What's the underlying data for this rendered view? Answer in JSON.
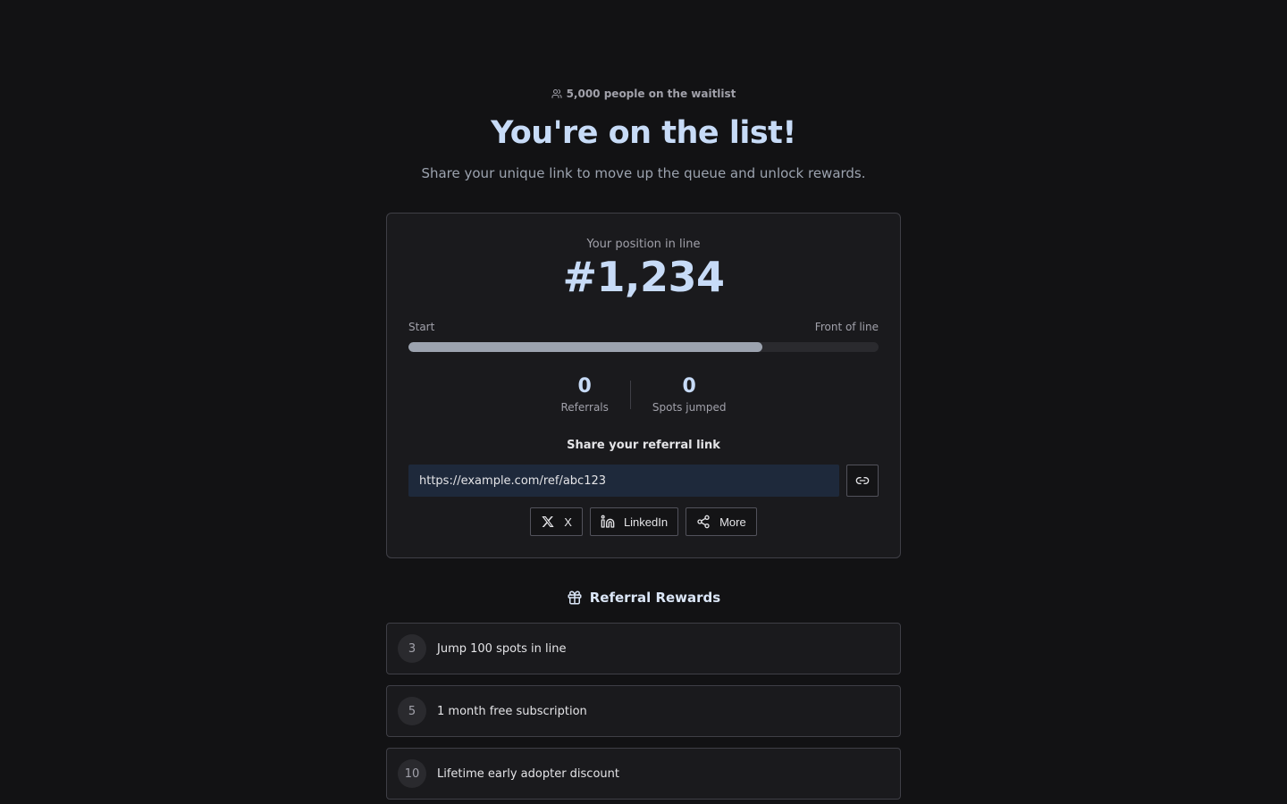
{
  "header": {
    "waitlist_count": "5,000 people on the waitlist",
    "title": "You're on the list!",
    "subtitle": "Share your unique link to move up the queue and unlock rewards."
  },
  "position": {
    "label": "Your position in line",
    "number": "#1,234",
    "progress_start_label": "Start",
    "progress_end_label": "Front of line",
    "progress_fraction": 0.753
  },
  "stats": {
    "referrals_value": "0",
    "referrals_label": "Referrals",
    "spots_value": "0",
    "spots_label": "Spots jumped"
  },
  "share": {
    "heading": "Share your referral link",
    "link": "https://example.com/ref/abc123",
    "buttons": {
      "x": "X",
      "linkedin": "LinkedIn",
      "more": "More"
    }
  },
  "rewards": {
    "heading": "Referral Rewards",
    "items": [
      {
        "count": "3",
        "text": "Jump 100 spots in line"
      },
      {
        "count": "5",
        "text": "1 month free subscription"
      },
      {
        "count": "10",
        "text": "Lifetime early adopter discount"
      }
    ]
  },
  "colors": {
    "accent": "#c7dbf7",
    "background": "#121214",
    "card": "#1a1a1d",
    "input": "#1e293b"
  }
}
